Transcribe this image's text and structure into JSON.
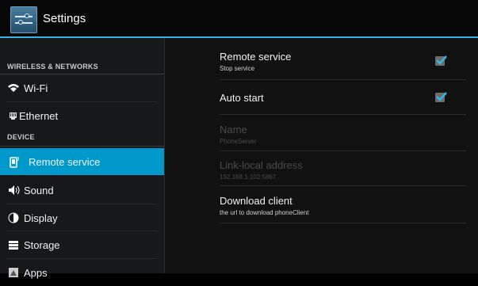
{
  "app": {
    "title": "Settings"
  },
  "sidebar": {
    "headers": [
      "WIRELESS & NETWORKS",
      "DEVICE"
    ],
    "items": [
      {
        "label": "Wi-Fi",
        "icon": "wifi-icon"
      },
      {
        "label": "Ethernet",
        "icon": "ethernet-icon"
      },
      {
        "label": "Remote service",
        "icon": "phone-icon"
      },
      {
        "label": "Sound",
        "icon": "speaker-icon"
      },
      {
        "label": "Display",
        "icon": "display-icon"
      },
      {
        "label": "Storage",
        "icon": "storage-icon"
      },
      {
        "label": "Apps",
        "icon": "apps-icon"
      }
    ]
  },
  "prefs": [
    {
      "title": "Remote service",
      "summary": "Stop service",
      "checked": true
    },
    {
      "title": "Auto start",
      "checked": true
    },
    {
      "title": "Name",
      "summary": "PhoneServer",
      "enabled": false
    },
    {
      "title": "Link-local address",
      "summary": "192.168.1.102:5867",
      "enabled": false
    },
    {
      "title": "Download client",
      "summary": "the url to download phoneClient"
    }
  ],
  "colors": {
    "accent": "#33b5e5",
    "selected": "#0099cc"
  }
}
